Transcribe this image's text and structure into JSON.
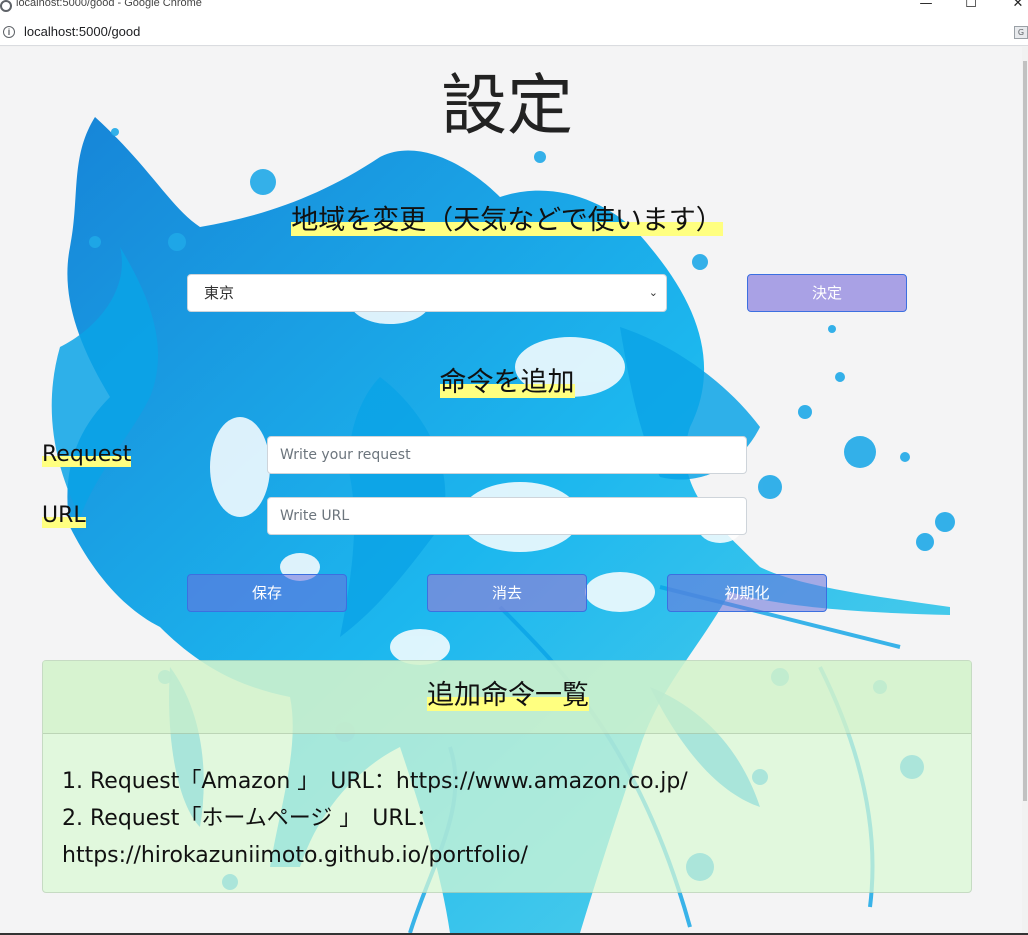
{
  "browser": {
    "window_title": "localhost:5000/good - Google Chrome",
    "url": "localhost:5000/good",
    "min_glyph": "—",
    "max_glyph": "☐",
    "close_glyph": "✕",
    "info_glyph": "i",
    "translate_glyph": "G"
  },
  "page": {
    "title": "設定",
    "region": {
      "heading": "地域を変更（天気などで使います）",
      "selected": "東京",
      "decide_label": "決定"
    },
    "add": {
      "heading": "命令を追加",
      "request_label": "Request",
      "request_placeholder": "Write your request",
      "url_label": "URL",
      "url_placeholder": "Write URL",
      "save_label": "保存",
      "clear_label": "消去",
      "reset_label": "初期化"
    },
    "list": {
      "heading": "追加命令一覧",
      "items": [
        "1. Request「Amazon 」　URL：https://www.amazon.co.jp/",
        "2. Request「ホームページ 」　URL：https://hirokazuniimoto.github.io/portfolio/"
      ]
    }
  },
  "colors": {
    "accent_highlight": "#ffff80",
    "button_border": "#3c6fe0",
    "card_bg": "#dafad4",
    "splash_blue": "#0aa3e6"
  }
}
